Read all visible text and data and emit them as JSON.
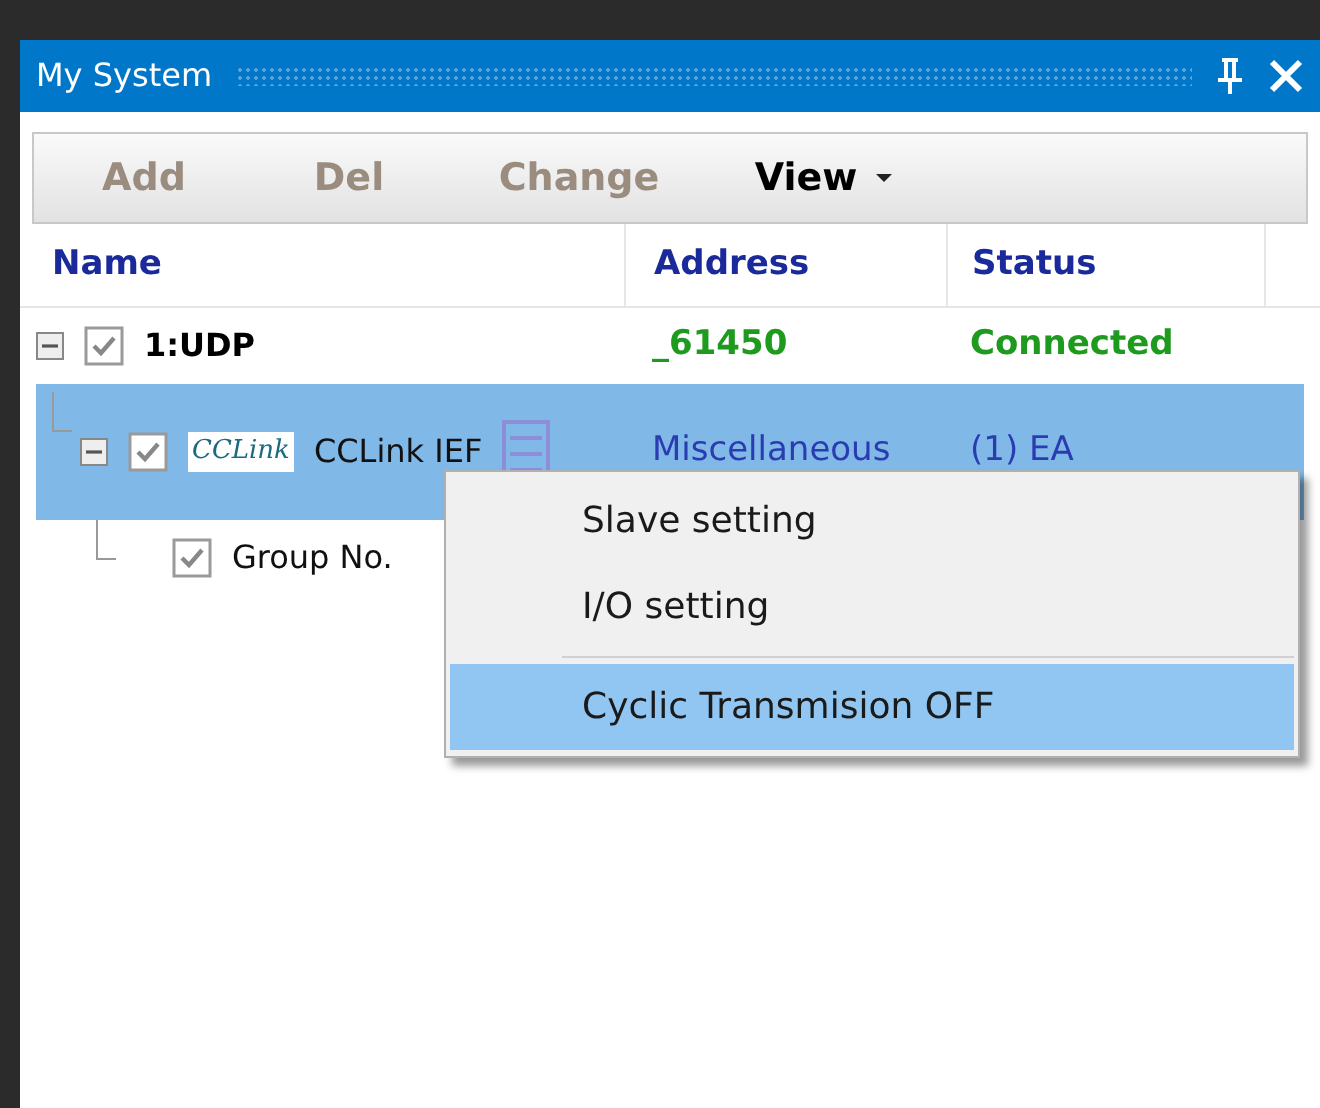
{
  "window": {
    "title": "My System"
  },
  "toolbar": [
    {
      "label": "Add",
      "disabled": true,
      "dropdown": false
    },
    {
      "label": "Del",
      "disabled": true,
      "dropdown": false
    },
    {
      "label": "Change",
      "disabled": true,
      "dropdown": false
    },
    {
      "label": "View",
      "disabled": false,
      "dropdown": true
    }
  ],
  "table": {
    "columns": [
      "Name",
      "Address",
      "Status"
    ],
    "rows": [
      {
        "name": "1:UDP",
        "checked": true,
        "expanded": true,
        "selected": false,
        "bold": true,
        "address": "_61450",
        "status": "Connected",
        "color": "#1e9a1e",
        "children": [
          {
            "name": "CCLink IEF",
            "logo": "CCLink",
            "checked": true,
            "expanded": true,
            "selected": true,
            "bold": false,
            "address": "Miscellaneous",
            "status": "(1) EA",
            "color": "#2a3cb0",
            "children": [
              {
                "name": "Group No.",
                "checked": true,
                "selected": false,
                "bold": false
              }
            ]
          }
        ]
      }
    ]
  },
  "context_menu": {
    "items": [
      {
        "label": "Slave setting",
        "selected": false,
        "separator_before": false
      },
      {
        "label": "I/O setting",
        "selected": false,
        "separator_before": false
      },
      {
        "label": "Cyclic Transmision OFF",
        "selected": true,
        "separator_before": true
      }
    ]
  }
}
